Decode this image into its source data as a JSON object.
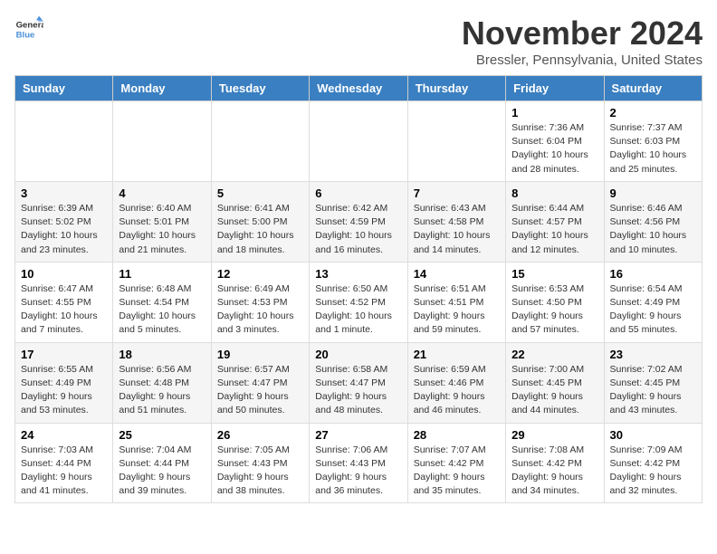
{
  "logo": {
    "general": "General",
    "blue": "Blue"
  },
  "header": {
    "month": "November 2024",
    "location": "Bressler, Pennsylvania, United States"
  },
  "weekdays": [
    "Sunday",
    "Monday",
    "Tuesday",
    "Wednesday",
    "Thursday",
    "Friday",
    "Saturday"
  ],
  "weeks": [
    [
      {
        "day": "",
        "info": ""
      },
      {
        "day": "",
        "info": ""
      },
      {
        "day": "",
        "info": ""
      },
      {
        "day": "",
        "info": ""
      },
      {
        "day": "",
        "info": ""
      },
      {
        "day": "1",
        "info": "Sunrise: 7:36 AM\nSunset: 6:04 PM\nDaylight: 10 hours and 28 minutes."
      },
      {
        "day": "2",
        "info": "Sunrise: 7:37 AM\nSunset: 6:03 PM\nDaylight: 10 hours and 25 minutes."
      }
    ],
    [
      {
        "day": "3",
        "info": "Sunrise: 6:39 AM\nSunset: 5:02 PM\nDaylight: 10 hours and 23 minutes."
      },
      {
        "day": "4",
        "info": "Sunrise: 6:40 AM\nSunset: 5:01 PM\nDaylight: 10 hours and 21 minutes."
      },
      {
        "day": "5",
        "info": "Sunrise: 6:41 AM\nSunset: 5:00 PM\nDaylight: 10 hours and 18 minutes."
      },
      {
        "day": "6",
        "info": "Sunrise: 6:42 AM\nSunset: 4:59 PM\nDaylight: 10 hours and 16 minutes."
      },
      {
        "day": "7",
        "info": "Sunrise: 6:43 AM\nSunset: 4:58 PM\nDaylight: 10 hours and 14 minutes."
      },
      {
        "day": "8",
        "info": "Sunrise: 6:44 AM\nSunset: 4:57 PM\nDaylight: 10 hours and 12 minutes."
      },
      {
        "day": "9",
        "info": "Sunrise: 6:46 AM\nSunset: 4:56 PM\nDaylight: 10 hours and 10 minutes."
      }
    ],
    [
      {
        "day": "10",
        "info": "Sunrise: 6:47 AM\nSunset: 4:55 PM\nDaylight: 10 hours and 7 minutes."
      },
      {
        "day": "11",
        "info": "Sunrise: 6:48 AM\nSunset: 4:54 PM\nDaylight: 10 hours and 5 minutes."
      },
      {
        "day": "12",
        "info": "Sunrise: 6:49 AM\nSunset: 4:53 PM\nDaylight: 10 hours and 3 minutes."
      },
      {
        "day": "13",
        "info": "Sunrise: 6:50 AM\nSunset: 4:52 PM\nDaylight: 10 hours and 1 minute."
      },
      {
        "day": "14",
        "info": "Sunrise: 6:51 AM\nSunset: 4:51 PM\nDaylight: 9 hours and 59 minutes."
      },
      {
        "day": "15",
        "info": "Sunrise: 6:53 AM\nSunset: 4:50 PM\nDaylight: 9 hours and 57 minutes."
      },
      {
        "day": "16",
        "info": "Sunrise: 6:54 AM\nSunset: 4:49 PM\nDaylight: 9 hours and 55 minutes."
      }
    ],
    [
      {
        "day": "17",
        "info": "Sunrise: 6:55 AM\nSunset: 4:49 PM\nDaylight: 9 hours and 53 minutes."
      },
      {
        "day": "18",
        "info": "Sunrise: 6:56 AM\nSunset: 4:48 PM\nDaylight: 9 hours and 51 minutes."
      },
      {
        "day": "19",
        "info": "Sunrise: 6:57 AM\nSunset: 4:47 PM\nDaylight: 9 hours and 50 minutes."
      },
      {
        "day": "20",
        "info": "Sunrise: 6:58 AM\nSunset: 4:47 PM\nDaylight: 9 hours and 48 minutes."
      },
      {
        "day": "21",
        "info": "Sunrise: 6:59 AM\nSunset: 4:46 PM\nDaylight: 9 hours and 46 minutes."
      },
      {
        "day": "22",
        "info": "Sunrise: 7:00 AM\nSunset: 4:45 PM\nDaylight: 9 hours and 44 minutes."
      },
      {
        "day": "23",
        "info": "Sunrise: 7:02 AM\nSunset: 4:45 PM\nDaylight: 9 hours and 43 minutes."
      }
    ],
    [
      {
        "day": "24",
        "info": "Sunrise: 7:03 AM\nSunset: 4:44 PM\nDaylight: 9 hours and 41 minutes."
      },
      {
        "day": "25",
        "info": "Sunrise: 7:04 AM\nSunset: 4:44 PM\nDaylight: 9 hours and 39 minutes."
      },
      {
        "day": "26",
        "info": "Sunrise: 7:05 AM\nSunset: 4:43 PM\nDaylight: 9 hours and 38 minutes."
      },
      {
        "day": "27",
        "info": "Sunrise: 7:06 AM\nSunset: 4:43 PM\nDaylight: 9 hours and 36 minutes."
      },
      {
        "day": "28",
        "info": "Sunrise: 7:07 AM\nSunset: 4:42 PM\nDaylight: 9 hours and 35 minutes."
      },
      {
        "day": "29",
        "info": "Sunrise: 7:08 AM\nSunset: 4:42 PM\nDaylight: 9 hours and 34 minutes."
      },
      {
        "day": "30",
        "info": "Sunrise: 7:09 AM\nSunset: 4:42 PM\nDaylight: 9 hours and 32 minutes."
      }
    ]
  ]
}
